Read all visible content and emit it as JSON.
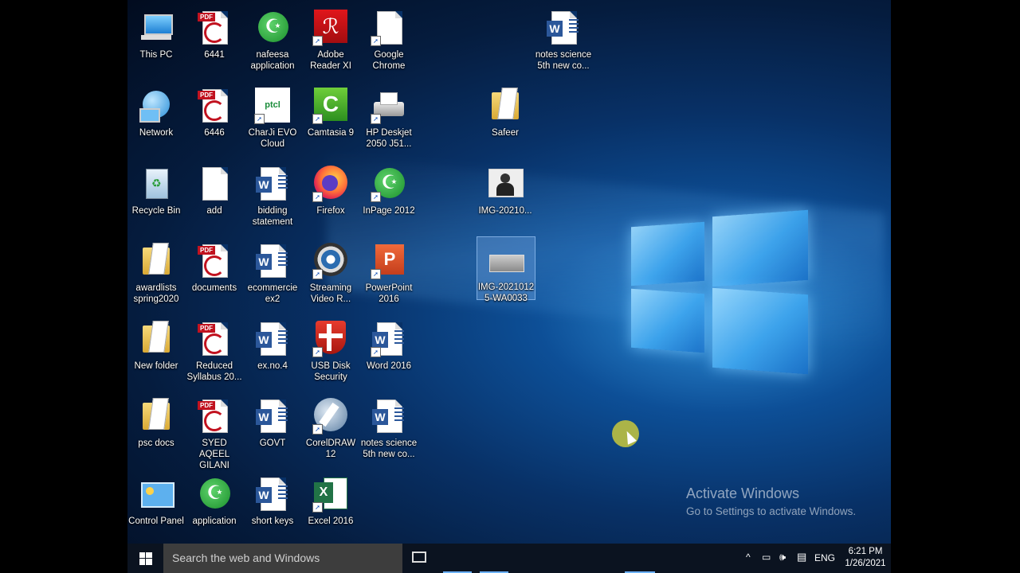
{
  "desktop": {
    "icons": [
      {
        "label": "This PC",
        "type": "pc"
      },
      {
        "label": "6441",
        "type": "pdf"
      },
      {
        "label": "nafeesa application",
        "type": "inpage"
      },
      {
        "label": "Adobe Reader XI",
        "type": "adobe"
      },
      {
        "label": "Google Chrome",
        "type": "blank"
      },
      {
        "label": "notes science 5th new co...",
        "type": "word"
      },
      {
        "label": "Network",
        "type": "network"
      },
      {
        "label": "6446",
        "type": "pdf"
      },
      {
        "label": "CharJi EVO Cloud",
        "type": "ptcl"
      },
      {
        "label": "Camtasia 9",
        "type": "camtasia"
      },
      {
        "label": "HP Deskjet 2050 J51...",
        "type": "printer"
      },
      {
        "label": "Safeer",
        "type": "folder"
      },
      {
        "label": "Recycle Bin",
        "type": "recycle"
      },
      {
        "label": "add",
        "type": "blank"
      },
      {
        "label": "bidding statement",
        "type": "word"
      },
      {
        "label": "Firefox",
        "type": "firefox"
      },
      {
        "label": "InPage 2012",
        "type": "inpage"
      },
      {
        "label": "IMG-20210...",
        "type": "photo"
      },
      {
        "label": "awardlists spring2020",
        "type": "folder"
      },
      {
        "label": "documents",
        "type": "pdf"
      },
      {
        "label": "ecommercie ex2",
        "type": "word"
      },
      {
        "label": "Streaming Video R...",
        "type": "streaming"
      },
      {
        "label": "PowerPoint 2016",
        "type": "powerpoint"
      },
      {
        "label": "IMG-2021012 5-WA0033",
        "type": "photo"
      },
      {
        "label": "New folder",
        "type": "folder"
      },
      {
        "label": "Reduced Syllabus 20...",
        "type": "pdf"
      },
      {
        "label": "ex.no.4",
        "type": "word"
      },
      {
        "label": "USB Disk Security",
        "type": "usb"
      },
      {
        "label": "Word 2016",
        "type": "word"
      },
      {
        "label": "psc docs",
        "type": "folder"
      },
      {
        "label": "SYED AQEEL GILANI",
        "type": "pdf"
      },
      {
        "label": "GOVT",
        "type": "word"
      },
      {
        "label": "CorelDRAW 12",
        "type": "corel"
      },
      {
        "label": "notes science 5th new co...",
        "type": "word"
      },
      {
        "label": "Control Panel",
        "type": "control"
      },
      {
        "label": "application",
        "type": "inpage"
      },
      {
        "label": "short keys",
        "type": "word"
      },
      {
        "label": "Excel 2016",
        "type": "excel"
      }
    ]
  },
  "watermark": {
    "title": "Activate Windows",
    "subtitle": "Go to Settings to activate Windows."
  },
  "taskbar": {
    "search_placeholder": "Search the web and Windows",
    "language": "ENG",
    "time": "6:21 PM",
    "date": "1/26/2021"
  }
}
